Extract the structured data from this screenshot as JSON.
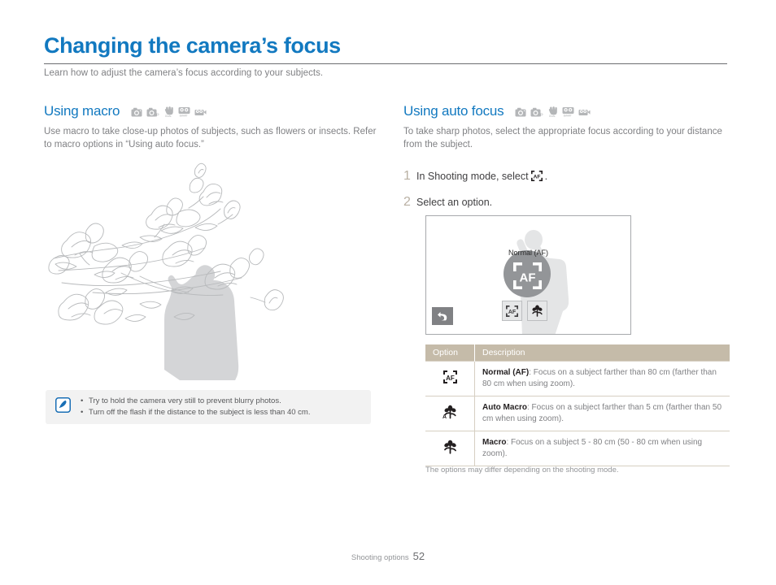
{
  "page": {
    "title": "Changing the camera’s focus",
    "subtitle": "Learn how to adjust the camera’s focus according to your subjects.",
    "accent_color": "#1279c0",
    "table_header_color": "#c5bba9",
    "footer": {
      "label": "Shooting options",
      "page_number": "52"
    }
  },
  "mode_icons": [
    {
      "name": "camera-auto-icon",
      "label": "Auto"
    },
    {
      "name": "camera-program-icon",
      "label": "Program"
    },
    {
      "name": "dual-is-icon",
      "label": "DUAL IS"
    },
    {
      "name": "smart-auto-icon",
      "label": "SMART"
    },
    {
      "name": "movie-icon",
      "label": "Movie"
    }
  ],
  "left_section": {
    "heading": "Using macro",
    "body": "Use macro to take close-up photos of subjects, such as flowers or insects. Refer to macro options in “Using auto focus.”",
    "illustration_name": "magnolia-branch-photographer-illustration",
    "note": {
      "icon": "note-pen-icon",
      "items": [
        "Try to hold the camera very still to prevent blurry photos.",
        "Turn off the flash if the distance to the subject is less than 40 cm."
      ]
    }
  },
  "right_section": {
    "heading": "Using auto focus",
    "body": "To take sharp photos, select the appropriate focus according to your distance from the subject.",
    "steps": [
      {
        "num": "1",
        "text_before": "In Shooting mode, select",
        "icon": "af-bracket-icon",
        "text_after": "."
      },
      {
        "num": "2",
        "text_before": "Select an option.",
        "icon": "",
        "text_after": ""
      }
    ],
    "lcd": {
      "label": "Normal (AF)",
      "selected_icon": "af-bracket-icon",
      "buttons": [
        {
          "name": "lcd-af-button",
          "icon": "af-bracket-icon"
        },
        {
          "name": "lcd-macro-button",
          "icon": "macro-flower-icon"
        }
      ],
      "back_button_icon": "back-arrow-icon"
    },
    "table": {
      "headers": [
        "Option",
        "Description"
      ],
      "rows": [
        {
          "icon": "af-bracket-icon",
          "option_name": "Normal (AF)",
          "description": ": Focus on a subject farther than 80 cm (farther than 80 cm when using zoom)."
        },
        {
          "icon": "auto-macro-flower-icon",
          "option_name": "Auto Macro",
          "description": ": Focus on a subject farther than 5 cm (farther than 50 cm when using zoom)."
        },
        {
          "icon": "macro-flower-icon",
          "option_name": "Macro",
          "description": ": Focus on a subject 5 - 80 cm (50 - 80 cm when using zoom)."
        }
      ],
      "caption": "The options may differ depending on the shooting mode."
    }
  }
}
